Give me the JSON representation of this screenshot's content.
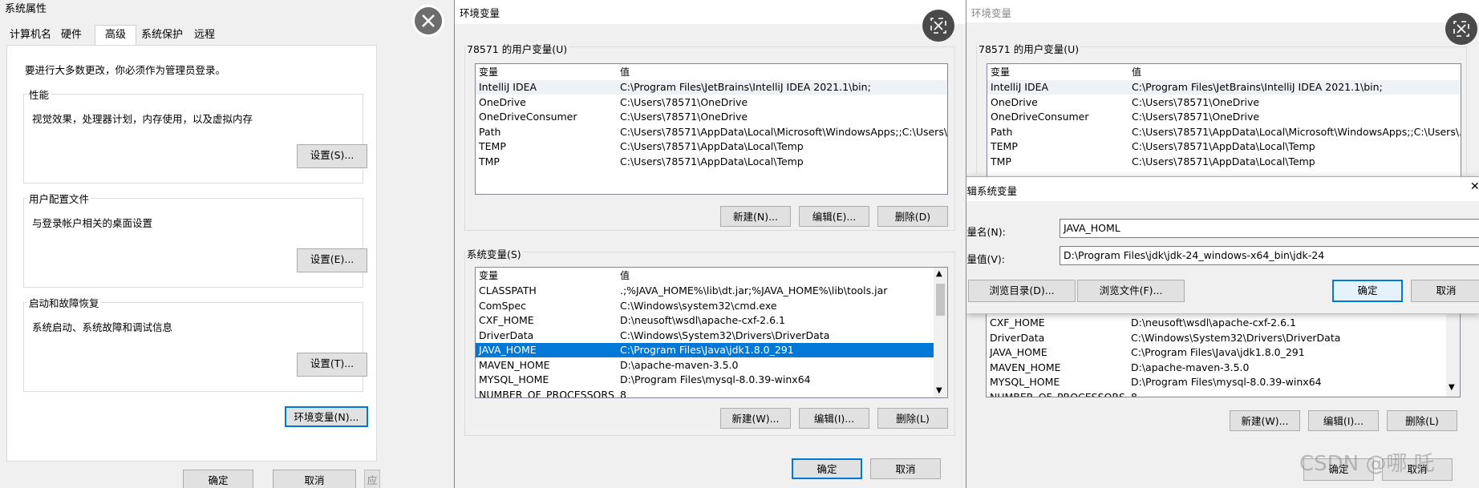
{
  "win1": {
    "title": "系统属性",
    "tabs": [
      "计算机名",
      "硬件",
      "高级",
      "系统保护",
      "远程"
    ],
    "admin_note": "要进行大多数更改，你必须作为管理员登录。",
    "perf": {
      "label": "性能",
      "desc": "视觉效果，处理器计划，内存使用，以及虚拟内存",
      "button": "设置(S)..."
    },
    "profile": {
      "label": "用户配置文件",
      "desc": "与登录帐户相关的桌面设置",
      "button": "设置(E)..."
    },
    "startup": {
      "label": "启动和故障恢复",
      "desc": "系统启动、系统故障和调试信息",
      "button": "设置(T)..."
    },
    "env_button": "环境变量(N)...",
    "ok": "确定",
    "cancel": "取消",
    "apply": "应用(A)"
  },
  "win2": {
    "title": "环境变量",
    "user_label": "78571 的用户变量(U)",
    "col_var": "变量",
    "col_val": "值",
    "user_vars": [
      {
        "name": "IntelliJ IDEA",
        "value": "C:\\Program Files\\JetBrains\\IntelliJ IDEA 2021.1\\bin;"
      },
      {
        "name": "OneDrive",
        "value": "C:\\Users\\78571\\OneDrive"
      },
      {
        "name": "OneDriveConsumer",
        "value": "C:\\Users\\78571\\OneDrive"
      },
      {
        "name": "Path",
        "value": "C:\\Users\\78571\\AppData\\Local\\Microsoft\\WindowsApps;;C:\\Users\\..."
      },
      {
        "name": "TEMP",
        "value": "C:\\Users\\78571\\AppData\\Local\\Temp"
      },
      {
        "name": "TMP",
        "value": "C:\\Users\\78571\\AppData\\Local\\Temp"
      }
    ],
    "user_btn_new": "新建(N)...",
    "user_btn_edit": "编辑(E)...",
    "user_btn_del": "删除(D)",
    "sys_label": "系统变量(S)",
    "sys_vars": [
      {
        "name": "CLASSPATH",
        "value": ".;%JAVA_HOME%\\lib\\dt.jar;%JAVA_HOME%\\lib\\tools.jar"
      },
      {
        "name": "ComSpec",
        "value": "C:\\Windows\\system32\\cmd.exe"
      },
      {
        "name": "CXF_HOME",
        "value": "D:\\neusoft\\wsdl\\apache-cxf-2.6.1"
      },
      {
        "name": "DriverData",
        "value": "C:\\Windows\\System32\\Drivers\\DriverData"
      },
      {
        "name": "JAVA_HOME",
        "value": "C:\\Program Files\\Java\\jdk1.8.0_291"
      },
      {
        "name": "MAVEN_HOME",
        "value": "D:\\apache-maven-3.5.0"
      },
      {
        "name": "MYSQL_HOME",
        "value": "D:\\Program Files\\mysql-8.0.39-winx64"
      },
      {
        "name": "NUMBER_OF_PROCESSORS",
        "value": "8"
      }
    ],
    "sys_btn_new": "新建(W)...",
    "sys_btn_edit": "编辑(I)...",
    "sys_btn_del": "删除(L)",
    "ok": "确定",
    "cancel": "取消"
  },
  "win3": {
    "title": "环境变量",
    "user_label": "78571 的用户变量(U)",
    "col_var": "变量",
    "col_val": "值",
    "user_vars": [
      {
        "name": "IntelliJ IDEA",
        "value": "C:\\Program Files\\JetBrains\\IntelliJ IDEA 2021.1\\bin;"
      },
      {
        "name": "OneDrive",
        "value": "C:\\Users\\78571\\OneDrive"
      },
      {
        "name": "OneDriveConsumer",
        "value": "C:\\Users\\78571\\OneDrive"
      },
      {
        "name": "Path",
        "value": "C:\\Users\\78571\\AppData\\Local\\Microsoft\\WindowsApps;;C:\\Users\\..."
      },
      {
        "name": "TEMP",
        "value": "C:\\Users\\78571\\AppData\\Local\\Temp"
      },
      {
        "name": "TMP",
        "value": "C:\\Users\\78571\\AppData\\Local\\Temp"
      }
    ],
    "sys_vars": [
      {
        "name": "CXF_HOME",
        "value": "D:\\neusoft\\wsdl\\apache-cxf-2.6.1"
      },
      {
        "name": "DriverData",
        "value": "C:\\Windows\\System32\\Drivers\\DriverData"
      },
      {
        "name": "JAVA_HOME",
        "value": "C:\\Program Files\\Java\\jdk1.8.0_291"
      },
      {
        "name": "MAVEN_HOME",
        "value": "D:\\apache-maven-3.5.0"
      },
      {
        "name": "MYSQL_HOME",
        "value": "D:\\Program Files\\mysql-8.0.39-winx64"
      },
      {
        "name": "NUMBER_OF_PROCESSORS",
        "value": "8"
      }
    ],
    "sys_btn_new": "新建(W)...",
    "sys_btn_edit": "编辑(I)...",
    "sys_btn_del": "删除(L)",
    "ok": "确定",
    "cancel": "取消"
  },
  "edit_dialog": {
    "title": "编辑系统变量",
    "name_label": "变量名(N):",
    "name_value": "JAVA_HOML",
    "value_label": "变量值(V):",
    "value_value": "D:\\Program Files\\jdk\\jdk-24_windows-x64_bin\\jdk-24",
    "browse_dir": "浏览目录(D)...",
    "browse_file": "浏览文件(F)...",
    "ok": "确定",
    "cancel": "取消"
  },
  "watermark": "CSDN @哪 吒",
  "icons": {
    "close": "close-icon",
    "screenshot": "screenshot-ocr-icon"
  },
  "colors": {
    "selection": "#0078d7",
    "default_border": "#0078d7"
  }
}
